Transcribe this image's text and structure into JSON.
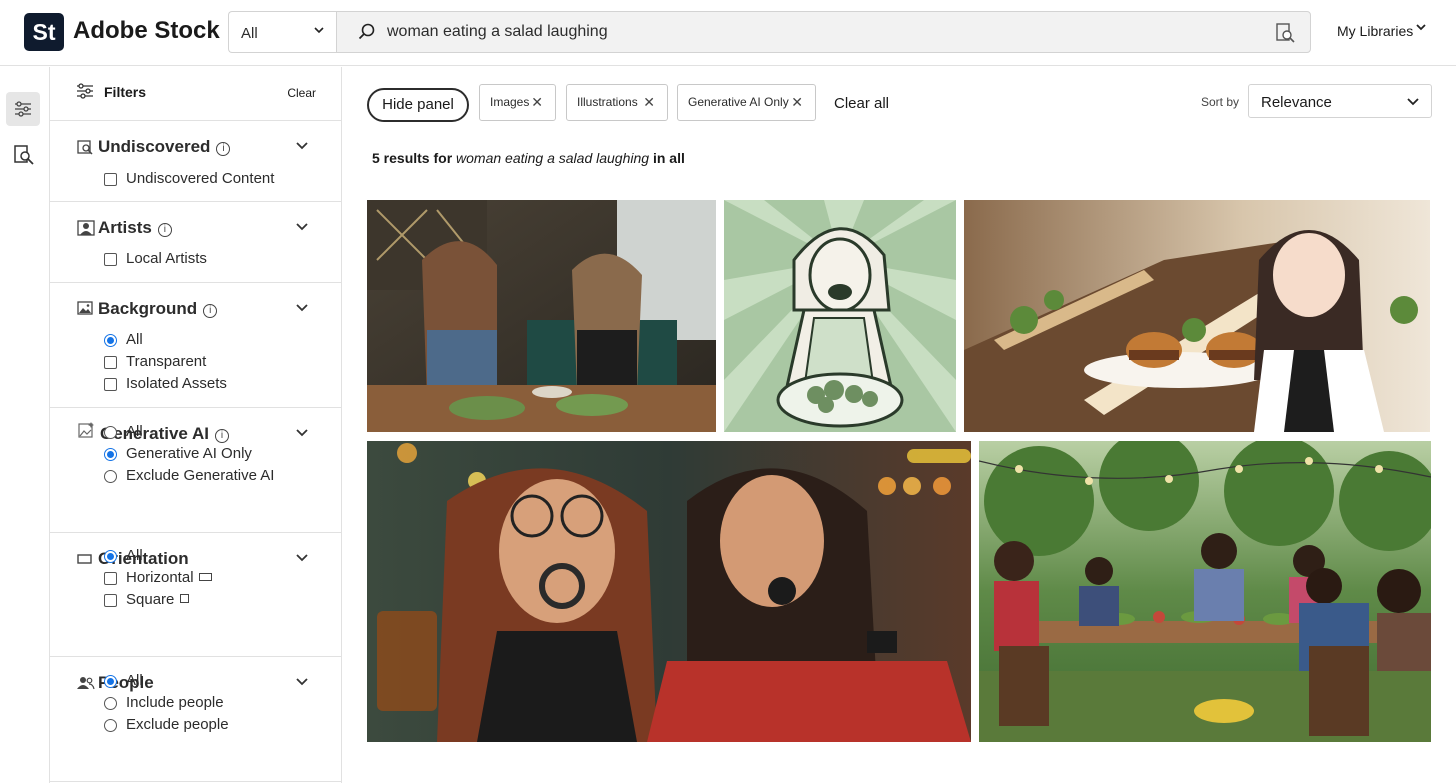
{
  "header": {
    "logo_text": "St",
    "brand": "Adobe Stock",
    "scope": "All",
    "query": "woman eating a salad laughing",
    "my_libraries": "My Libraries"
  },
  "rail": {
    "icons": [
      "filters-icon",
      "visual-search-icon"
    ]
  },
  "filters": {
    "title": "Filters",
    "clear": "Clear",
    "sections": [
      {
        "title": "Undiscovered",
        "options": [
          {
            "label": "Undiscovered Content",
            "type": "checkbox",
            "checked": false
          }
        ]
      },
      {
        "title": "Artists",
        "options": [
          {
            "label": "Local Artists",
            "type": "checkbox",
            "checked": false
          }
        ]
      },
      {
        "title": "Background",
        "options": [
          {
            "label": "All",
            "type": "radio",
            "checked": true
          },
          {
            "label": "Transparent",
            "type": "checkbox",
            "checked": false
          },
          {
            "label": "Isolated Assets",
            "type": "checkbox",
            "checked": false
          }
        ]
      },
      {
        "title": "Generative AI",
        "options": [
          {
            "label": "All",
            "type": "radio",
            "checked": false
          },
          {
            "label": "Generative AI Only",
            "type": "radio",
            "checked": true
          },
          {
            "label": "Exclude Generative AI",
            "type": "radio",
            "checked": false
          }
        ]
      },
      {
        "title": "Orientation",
        "options": [
          {
            "label": "All",
            "type": "radio",
            "checked": true
          },
          {
            "label": "Horizontal",
            "type": "checkbox",
            "checked": false
          },
          {
            "label": "Square",
            "type": "checkbox",
            "checked": false
          }
        ]
      },
      {
        "title": "People",
        "options": [
          {
            "label": "All",
            "type": "radio",
            "checked": true
          },
          {
            "label": "Include people",
            "type": "radio",
            "checked": false
          },
          {
            "label": "Exclude people",
            "type": "radio",
            "checked": false
          }
        ]
      }
    ]
  },
  "toolbar": {
    "hide_panel": "Hide panel",
    "chips": [
      "Images",
      "Illustrations",
      "Generative AI Only"
    ],
    "clear_all": "Clear all",
    "sort_label": "Sort by",
    "sort_value": "Relevance"
  },
  "results": {
    "count_text": "5 results for",
    "query": "woman eating a salad laughing",
    "scope_prefix": "in",
    "scope": "all"
  },
  "images": [
    {
      "name": "image-two-women-laughing-restaurant"
    },
    {
      "name": "image-retro-woman-salad-illustration"
    },
    {
      "name": "image-anime-waitress-burgers"
    },
    {
      "name": "image-two-women-bokeh-portrait"
    },
    {
      "name": "image-friends-outdoor-dinner"
    }
  ]
}
